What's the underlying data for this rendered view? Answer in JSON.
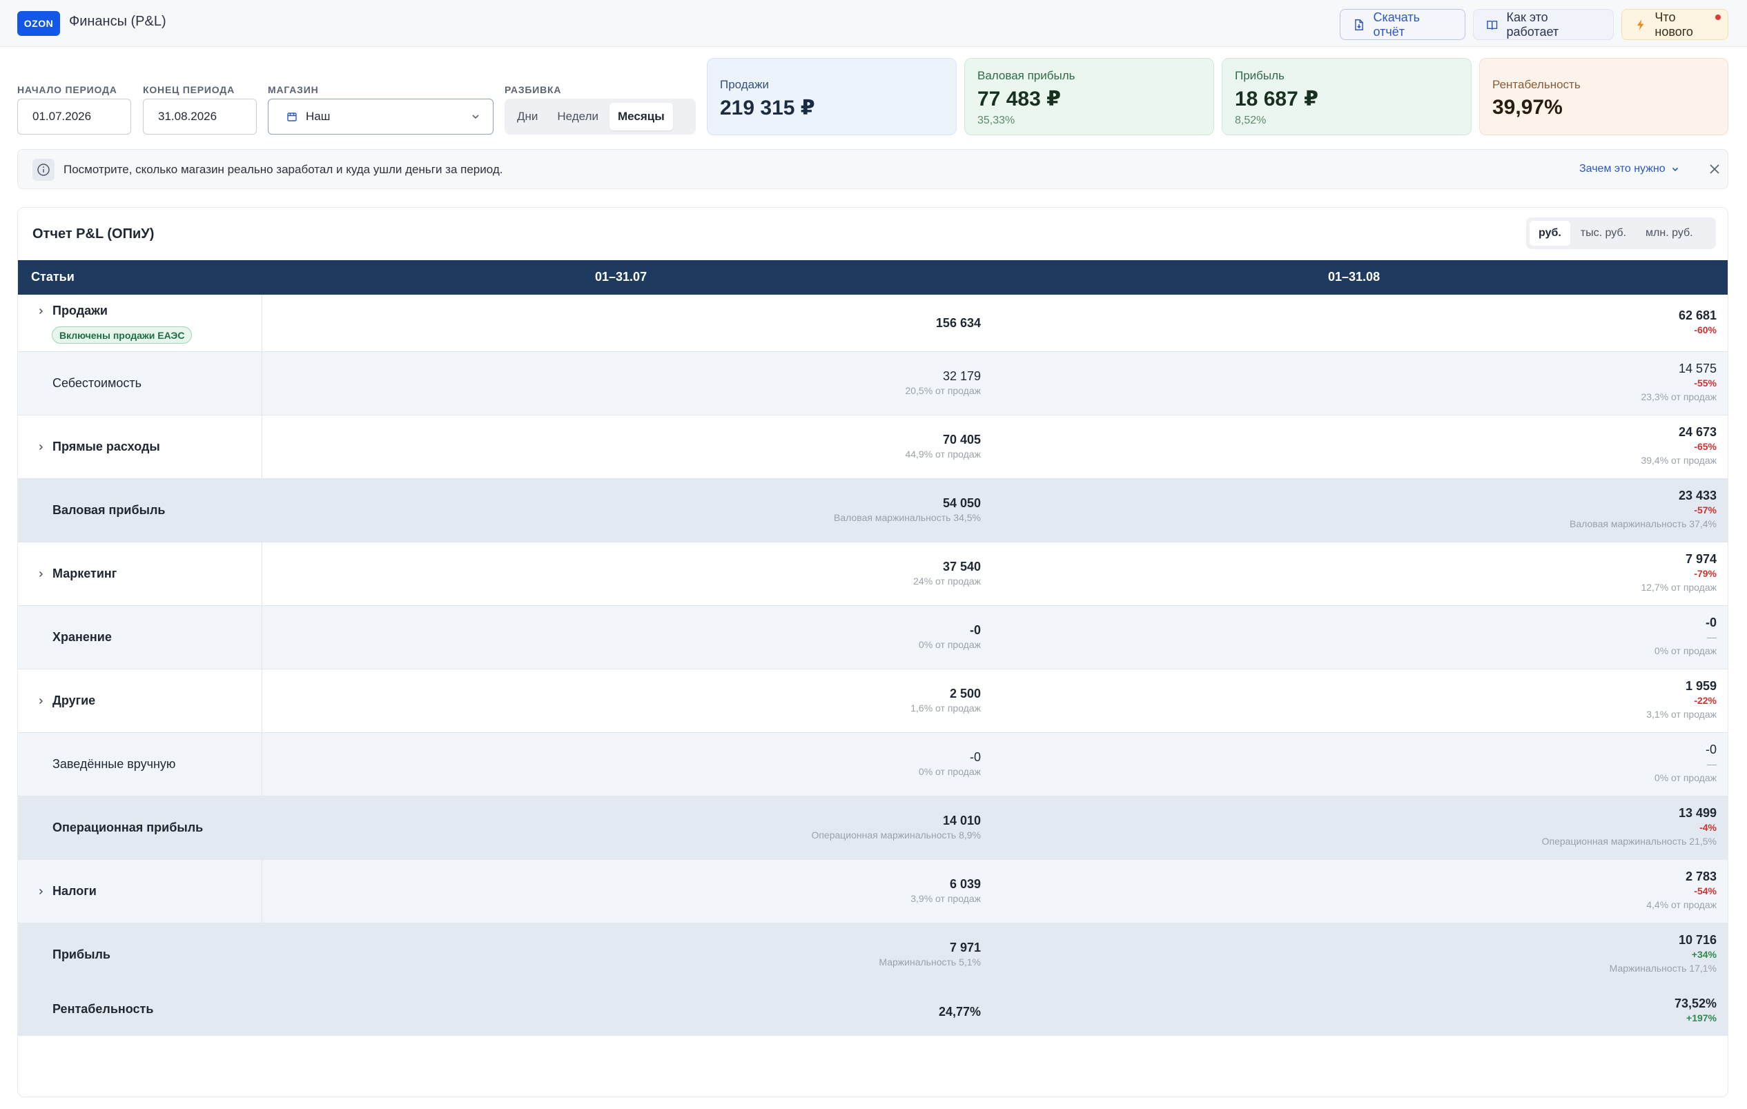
{
  "header": {
    "logo": "OZON",
    "title": "Финансы (P&L)",
    "download_label": "Скачать отчёт",
    "how_label": "Как это работает",
    "new_label": "Что нового"
  },
  "filters": {
    "start_label": "НАЧАЛО ПЕРИОДА",
    "start_value": "01.07.2026",
    "end_label": "КОНЕЦ ПЕРИОДА",
    "end_value": "31.08.2026",
    "store_label": "МАГАЗИН",
    "store_value": "Наш",
    "split_label": "РАЗБИВКА",
    "split_options": [
      "Дни",
      "Недели",
      "Месяцы"
    ],
    "split_selected": "Месяцы"
  },
  "kpis": {
    "sales": {
      "label": "Продажи",
      "value": "219 315 ₽"
    },
    "gross": {
      "label": "Валовая прибыль",
      "value": "77 483 ₽",
      "sub": "35,33%"
    },
    "profit": {
      "label": "Прибыль",
      "value": "18 687 ₽",
      "sub": "8,52%"
    },
    "margin": {
      "label": "Рентабельность",
      "value": "39,97%"
    }
  },
  "banner": {
    "text": "Посмотрите, сколько магазин реально заработал и куда ушли деньги за период.",
    "link": "Зачем это нужно"
  },
  "report": {
    "title": "Отчет P&L (ОПиУ)",
    "units": [
      "руб.",
      "тыс. руб.",
      "млн. руб."
    ],
    "unit_selected": "руб.",
    "columns": [
      "Статьи",
      "01–31.07",
      "01–31.08"
    ],
    "rows": [
      {
        "name": "Продажи",
        "badge": "Включены продажи ЕАЭС",
        "c1": {
          "v": "156 634"
        },
        "c2": {
          "v": "62 681",
          "d": "-60%"
        }
      },
      {
        "name": "Себестоимость",
        "c1": {
          "v": "32 179",
          "s": "20,5% от продаж"
        },
        "c2": {
          "v": "14 575",
          "d": "-55%",
          "s": "23,3% от продаж"
        }
      },
      {
        "name": "Прямые расходы",
        "c1": {
          "v": "70 405",
          "s": "44,9% от продаж"
        },
        "c2": {
          "v": "24 673",
          "d": "-65%",
          "s": "39,4% от продаж"
        }
      },
      {
        "name": "Валовая прибыль",
        "c1": {
          "v": "54 050",
          "s": "Валовая маржинальность 34,5%"
        },
        "c2": {
          "v": "23 433",
          "d": "-57%",
          "s": "Валовая маржинальность 37,4%"
        }
      },
      {
        "name": "Маркетинг",
        "c1": {
          "v": "37 540",
          "s": "24% от продаж"
        },
        "c2": {
          "v": "7 974",
          "d": "-79%",
          "s": "12,7% от продаж"
        }
      },
      {
        "name": "Хранение",
        "c1": {
          "v": "-0",
          "s": "0% от продаж"
        },
        "c2": {
          "v": "-0",
          "d": "—",
          "s": "0% от продаж"
        }
      },
      {
        "name": "Другие",
        "c1": {
          "v": "2 500",
          "s": "1,6% от продаж"
        },
        "c2": {
          "v": "1 959",
          "d": "-22%",
          "s": "3,1% от продаж"
        }
      },
      {
        "name": "Заведённые вручную",
        "c1": {
          "v": "-0",
          "s": "0% от продаж"
        },
        "c2": {
          "v": "-0",
          "d": "—",
          "s": "0% от продаж"
        }
      },
      {
        "name": "Операционная прибыль",
        "c1": {
          "v": "14 010",
          "s": "Операционная маржинальность 8,9%"
        },
        "c2": {
          "v": "13 499",
          "d": "-4%",
          "s": "Операционная маржинальность 21,5%"
        }
      },
      {
        "name": "Налоги",
        "c1": {
          "v": "6 039",
          "s": "3,9% от продаж"
        },
        "c2": {
          "v": "2 783",
          "d": "-54%",
          "s": "4,4% от продаж"
        }
      },
      {
        "name": "Прибыль",
        "c1": {
          "v": "7 971",
          "s": "Маржинальность 5,1%"
        },
        "c2": {
          "v": "10 716",
          "d": "+34%",
          "s": "Маржинальность 17,1%"
        }
      },
      {
        "name": "Рентабельность",
        "c1": {
          "v": "24,77%"
        },
        "c2": {
          "v": "73,52%",
          "d": "+197%"
        }
      }
    ]
  },
  "colors": {
    "brand": "#1357e8",
    "table_header": "#1e3a5f",
    "negative": "#d32f2f",
    "positive": "#2e8b4e"
  }
}
